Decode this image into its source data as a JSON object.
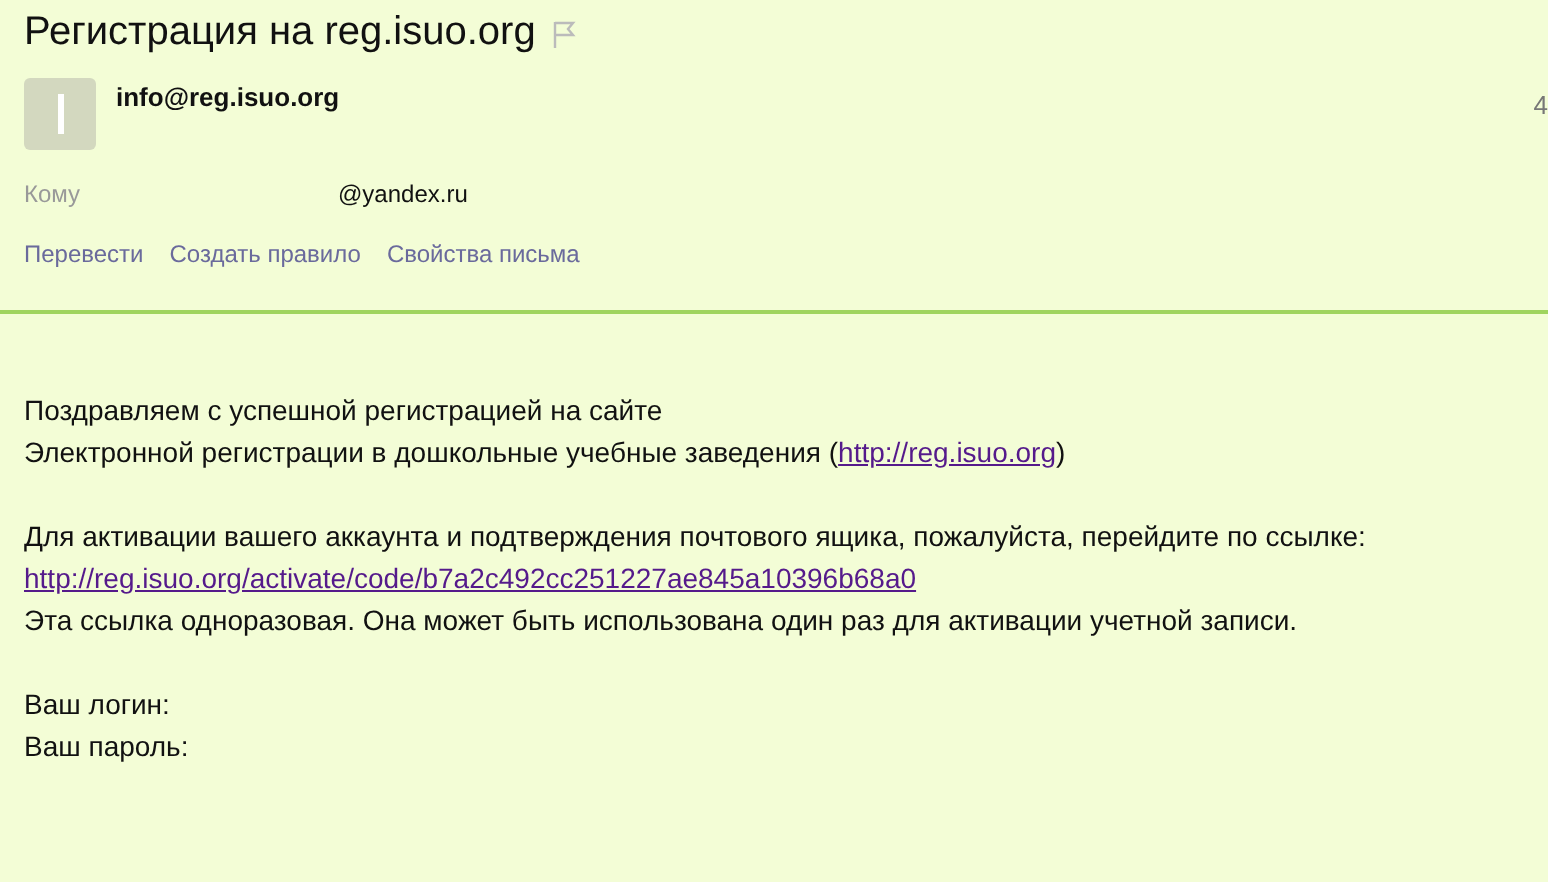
{
  "subject": "Регистрация на reg.isuo.org",
  "sender": "info@reg.isuo.org",
  "date": "4",
  "recipient": {
    "label": "Кому",
    "value": "@yandex.ru"
  },
  "actions": [
    "Перевести",
    "Создать правило",
    "Свойства письма"
  ],
  "paragraphs": [
    [
      {
        "kind": "text",
        "text": "Поздравляем с успешной регистрацией на сайте"
      },
      {
        "kind": "text_link",
        "before": "Электронной регистрации в дошкольные учебные заведения (",
        "link": "http://reg.isuo.org",
        "after": ")"
      }
    ],
    [
      {
        "kind": "text",
        "text": "Для активации вашего аккаунта и подтверждения почтового ящика, пожалуйста, перейдите по ссылке:"
      },
      {
        "kind": "link",
        "link": "http://reg.isuo.org/activate/code/b7a2c492cc251227ae845a10396b68a0"
      },
      {
        "kind": "text",
        "text": "Эта ссылка одноразовая. Она может быть использована один раз для активации учетной записи."
      }
    ],
    [
      {
        "kind": "text",
        "text": "Ваш логин:"
      },
      {
        "kind": "text",
        "text": "Ваш пароль:"
      }
    ]
  ]
}
